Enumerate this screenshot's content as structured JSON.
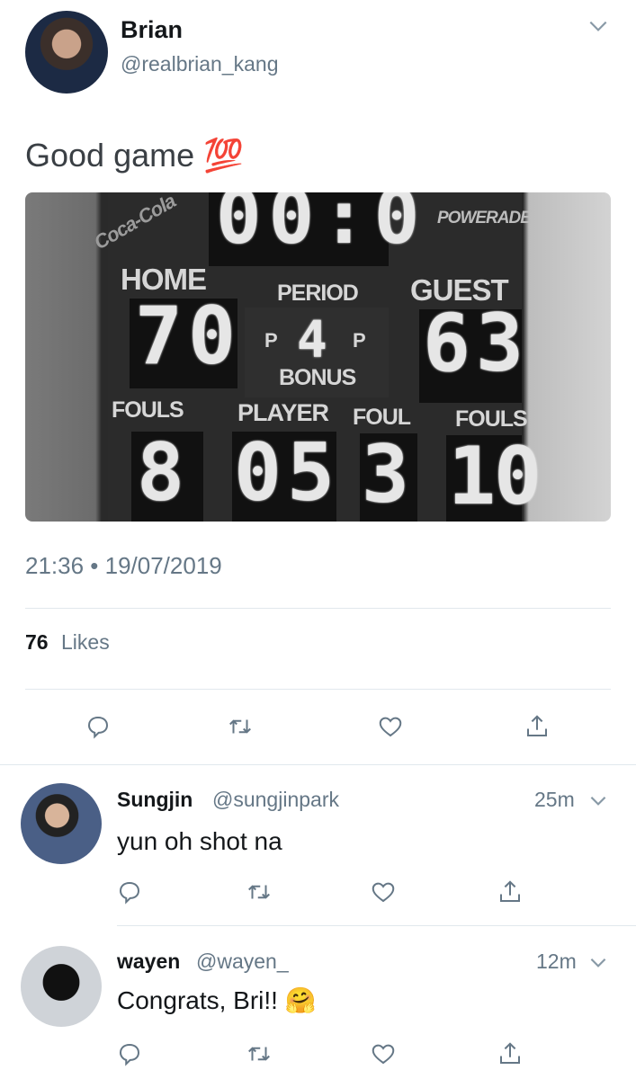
{
  "tweet": {
    "display_name": "Brian",
    "handle": "@realbrian_kang",
    "text": "Good game 💯",
    "timestamp": "21:36 • 19/07/2019",
    "likes_count": "76",
    "likes_label": "Likes",
    "image": {
      "clock": "00:0",
      "brand": "POWERADE",
      "brand_left": "Coca-Cola",
      "home_label": "HOME",
      "guest_label": "GUEST",
      "period_label": "PERIOD",
      "period_value": "4",
      "poss_left": "P",
      "poss_right": "P",
      "bonus_label": "BONUS",
      "home_score": "70",
      "guest_score": "63",
      "fouls_label_left": "FOULS",
      "player_label": "PLAYER",
      "foul_label": "FOUL",
      "fouls_label_right": "FOULS",
      "home_fouls": "8",
      "player_number": "05",
      "player_foul": "3",
      "guest_fouls": "10"
    }
  },
  "replies": [
    {
      "display_name": "Sungjin",
      "handle": "@sungjinpark",
      "time": "25m",
      "text": "yun oh shot na"
    },
    {
      "display_name": "wayen",
      "handle": "@wayen_",
      "time": "12m",
      "text": "Congrats, Bri!! 🤗"
    }
  ],
  "icons": {
    "reply": "reply-icon",
    "retweet": "retweet-icon",
    "like": "like-icon",
    "share": "share-icon",
    "more": "chevron-down-icon"
  },
  "colors": {
    "text": "#14171a",
    "muted": "#657786",
    "divider": "#e1e8ed"
  }
}
